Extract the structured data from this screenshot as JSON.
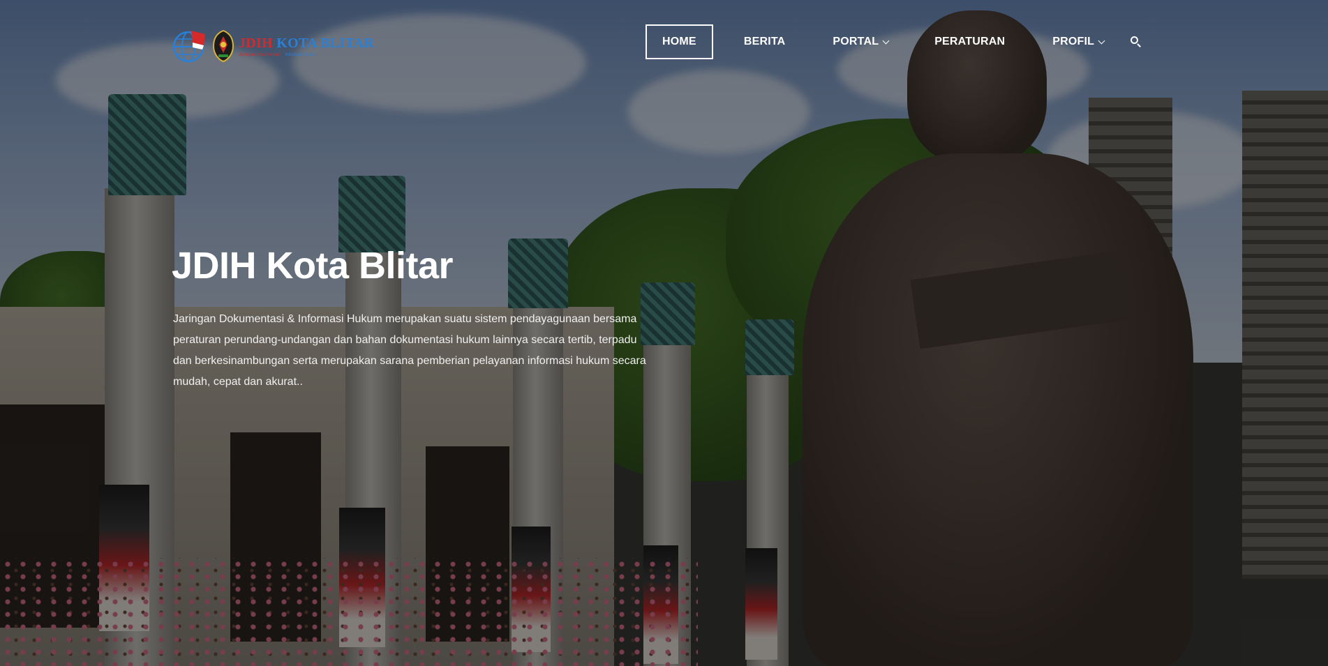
{
  "logo": {
    "title_part1": "JDIH",
    "title_part2": "KOTA BLITAR",
    "subtitle_part1": "Jaringan Dokumentasi",
    "subtitle_part2": "Informasi Hukum"
  },
  "nav": {
    "items": [
      {
        "label": "HOME",
        "active": true,
        "dropdown": false
      },
      {
        "label": "BERITA",
        "active": false,
        "dropdown": false
      },
      {
        "label": "PORTAL",
        "active": false,
        "dropdown": true
      },
      {
        "label": "PERATURAN",
        "active": false,
        "dropdown": false
      },
      {
        "label": "PROFIL",
        "active": false,
        "dropdown": true
      }
    ],
    "search_icon": "search-icon"
  },
  "hero": {
    "title": "JDIH Kota Blitar",
    "description": "Jaringan Dokumentasi & Informasi Hukum merupakan suatu sistem pendayagunaan bersama peraturan perundang-undangan dan bahan dokumentasi hukum lainnya secara tertib, terpadu dan berkesinambungan serta merupakan sarana pemberian pelayanan informasi hukum secara mudah, cepat dan akurat.."
  },
  "colors": {
    "logo_red": "#d62a2a",
    "logo_blue": "#2a7fd6",
    "nav_text": "#ffffff",
    "overlay": "rgba(0,0,0,0.45)"
  }
}
